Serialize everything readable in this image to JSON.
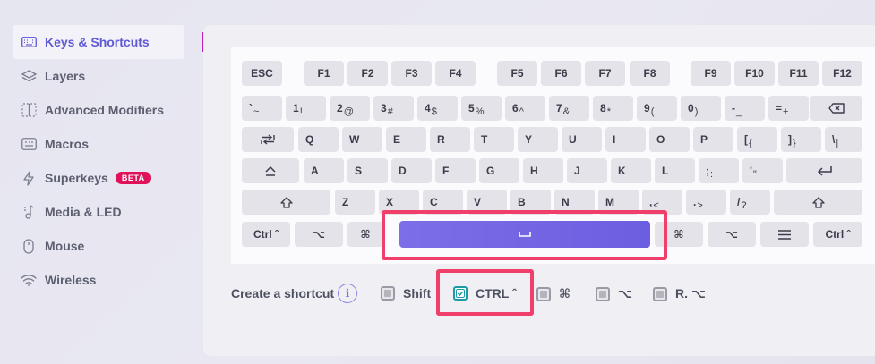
{
  "sidebar": {
    "items": [
      {
        "label": "Keys & Shortcuts",
        "icon": "keyboard-icon",
        "active": true
      },
      {
        "label": "Layers",
        "icon": "layers-icon"
      },
      {
        "label": "Advanced Modifiers",
        "icon": "advanced-modifiers-icon"
      },
      {
        "label": "Macros",
        "icon": "macros-icon"
      },
      {
        "label": "Superkeys",
        "icon": "lightning-icon",
        "badge": "BETA"
      },
      {
        "label": "Media & LED",
        "icon": "music-note-icon"
      },
      {
        "label": "Mouse",
        "icon": "mouse-icon"
      },
      {
        "label": "Wireless",
        "icon": "wifi-icon"
      }
    ]
  },
  "keyboard": {
    "fn_row": [
      "ESC",
      "F1",
      "F2",
      "F3",
      "F4",
      "F5",
      "F6",
      "F7",
      "F8",
      "F9",
      "F10",
      "F11",
      "F12"
    ],
    "num_row": [
      {
        "main": "`",
        "sub": "~"
      },
      {
        "main": "1",
        "sub": "!"
      },
      {
        "main": "2",
        "sub": "@"
      },
      {
        "main": "3",
        "sub": "#"
      },
      {
        "main": "4",
        "sub": "$"
      },
      {
        "main": "5",
        "sub": "%"
      },
      {
        "main": "6",
        "sub": "^"
      },
      {
        "main": "7",
        "sub": "&"
      },
      {
        "main": "8",
        "sub": "*"
      },
      {
        "main": "9",
        "sub": "("
      },
      {
        "main": "0",
        "sub": ")"
      },
      {
        "main": "-",
        "sub": "_"
      },
      {
        "main": "=",
        "sub": "+"
      }
    ],
    "q_row": [
      "Q",
      "W",
      "E",
      "R",
      "T",
      "Y",
      "U",
      "I",
      "O",
      "P"
    ],
    "q_row_dual": [
      {
        "main": "[",
        "sub": "{"
      },
      {
        "main": "]",
        "sub": "}"
      },
      {
        "main": "\\",
        "sub": "|"
      }
    ],
    "a_row": [
      "A",
      "S",
      "D",
      "F",
      "G",
      "H",
      "J",
      "K",
      "L"
    ],
    "a_row_dual": [
      {
        "main": ";",
        "sub": ":"
      },
      {
        "main": "'",
        "sub": "\""
      }
    ],
    "z_row": [
      "Z",
      "X",
      "C",
      "V",
      "B",
      "N",
      "M"
    ],
    "z_row_dual": [
      {
        "main": ",",
        "sub": "<"
      },
      {
        "main": ".",
        "sub": ">"
      },
      {
        "main": "/",
        "sub": "?"
      }
    ],
    "bottom": {
      "ctrl_left": "Ctrl ˆ",
      "alt_left": "⌥",
      "cmd_left": "⌘",
      "cmd_right": "⌘",
      "alt_right": "⌥",
      "ctrl_right": "Ctrl ˆ"
    }
  },
  "shortcut": {
    "label": "Create a shortcut",
    "info": "i",
    "options": [
      {
        "label": "Shift",
        "checked": false
      },
      {
        "label": "CTRL ˆ",
        "checked": true
      },
      {
        "label": "⌘",
        "checked": false
      },
      {
        "label": "⌥",
        "checked": false
      },
      {
        "label": "R. ⌥",
        "checked": false
      }
    ]
  },
  "colors": {
    "accent": "#6a63d9",
    "highlight": "#ef3f6a",
    "badge": "#e0125a",
    "check": "#1f9aa5"
  }
}
